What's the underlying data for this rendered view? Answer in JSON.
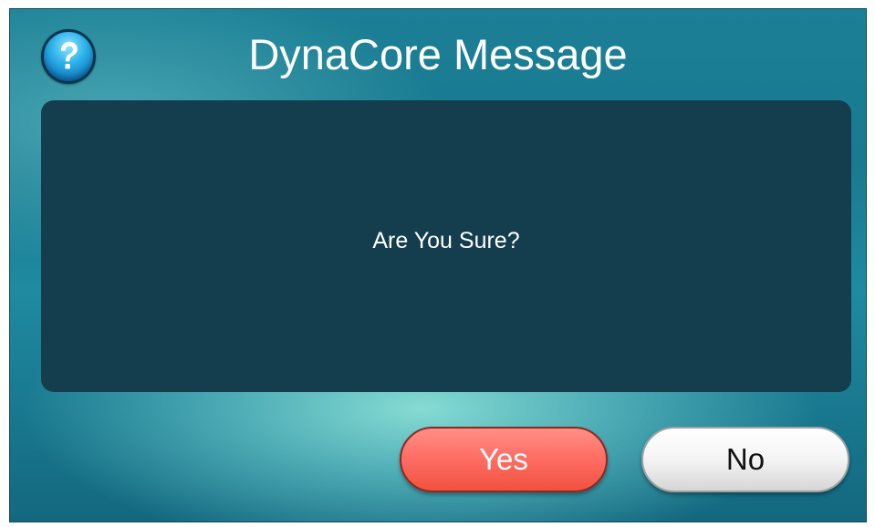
{
  "dialog": {
    "title": "DynaCore Message",
    "help_icon": "question-mark-icon",
    "message": "Are You Sure?",
    "buttons": {
      "yes_label": "Yes",
      "no_label": "No"
    }
  },
  "colors": {
    "panel_background": "#143d4d",
    "yes_button": "#ff6f66",
    "no_button": "#f4f4f4",
    "dialog_teal": "#1b7f95"
  }
}
